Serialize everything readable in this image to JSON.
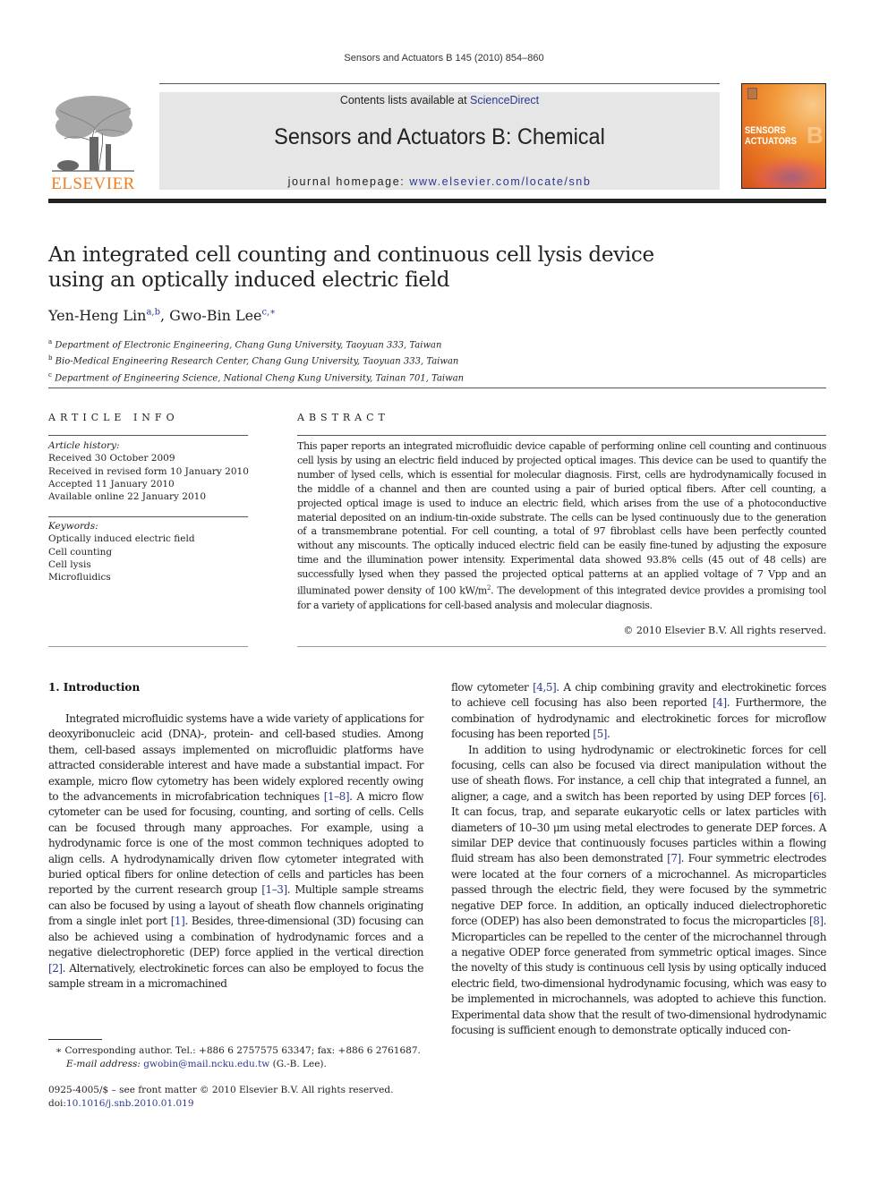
{
  "journal": {
    "running_head": "Sensors and Actuators B 145 (2010) 854–860",
    "contents_prefix": "Contents lists available at ",
    "contents_link": "ScienceDirect",
    "name": "Sensors and Actuators B: Chemical",
    "homepage_prefix": "journal homepage: ",
    "homepage_url": "www.elsevier.com/locate/snb",
    "publisher_logo": "ELSEVIER",
    "cover_title_line1": "SENSORS",
    "cover_title_line2": "ACTUATORS",
    "cover_letter": "B",
    "colors": {
      "link": "#2b3990",
      "logo_orange": "#f07d1f",
      "banner_bg": "#e6e6e6"
    }
  },
  "article": {
    "title_line1": "An integrated cell counting and continuous cell lysis device",
    "title_line2": "using an optically induced electric field",
    "authors": [
      {
        "name": "Yen-Heng Lin",
        "marks": "a,b"
      },
      {
        "name": "Gwo-Bin Lee",
        "marks": "c,∗"
      }
    ],
    "affiliations": [
      {
        "mark": "a",
        "text": "Department of Electronic Engineering, Chang Gung University, Taoyuan 333, Taiwan"
      },
      {
        "mark": "b",
        "text": "Bio-Medical Engineering Research Center, Chang Gung University, Taoyuan 333, Taiwan"
      },
      {
        "mark": "c",
        "text": "Department of Engineering Science, National Cheng Kung University, Tainan 701, Taiwan"
      }
    ]
  },
  "article_info": {
    "heading": "ARTICLE INFO",
    "history_label": "Article history:",
    "history": [
      "Received 30 October 2009",
      "Received in revised form 10 January 2010",
      "Accepted 11 January 2010",
      "Available online 22 January 2010"
    ],
    "keywords_label": "Keywords:",
    "keywords": [
      "Optically induced electric field",
      "Cell counting",
      "Cell lysis",
      "Microfluidics"
    ]
  },
  "abstract": {
    "heading": "ABSTRACT",
    "text_part1": "This paper reports an integrated microfluidic device capable of performing online cell counting and continuous cell lysis by using an electric field induced by projected optical images. This device can be used to quantify the number of lysed cells, which is essential for molecular diagnosis. First, cells are hydrodynamically focused in the middle of a channel and then are counted using a pair of buried optical fibers. After cell counting, a projected optical image is used to induce an electric field, which arises from the use of a photoconductive material deposited on an indium-tin-oxide substrate. The cells can be lysed continuously due to the generation of a transmembrane potential. For cell counting, a total of 97 fibroblast cells have been perfectly counted without any miscounts. The optically induced electric field can be easily fine-tuned by adjusting the exposure time and the illumination power intensity. Experimental data showed 93.8% cells (45 out of 48 cells) are successfully lysed when they passed the projected optical patterns at an applied voltage of 7 Vpp and an illuminated power density of 100 kW/m",
    "text_sup": "2",
    "text_part2": ". The development of this integrated device provides a promising tool for a variety of applications for cell-based analysis and molecular diagnosis.",
    "copyright": "© 2010 Elsevier B.V. All rights reserved."
  },
  "introduction": {
    "heading": "1.  Introduction",
    "left_p1": [
      {
        "t": "Integrated microfluidic systems have a wide variety of applications for deoxyribonucleic acid (DNA)-, protein- and cell-based studies. Among them, cell-based assays implemented on microfluidic platforms have attracted considerable interest and have made a substantial impact. For example, micro flow cytometry has been widely explored recently owing to the advancements in microfabrication techniques "
      },
      {
        "ref": "[1–8]"
      },
      {
        "t": ". A micro flow cytometer can be used for focusing, counting, and sorting of cells. Cells can be focused through many approaches. For example, using a hydrodynamic force is one of the most common techniques adopted to align cells. A hydrodynamically driven flow cytometer integrated with buried optical fibers for online detection of cells and particles has been reported by the current research group "
      },
      {
        "ref": "[1–3]"
      },
      {
        "t": ". Multiple sample streams can also be focused by using a layout of sheath flow channels originating from a single inlet port "
      },
      {
        "ref": "[1]"
      },
      {
        "t": ". Besides, three-dimensional (3D) focusing can also be achieved using a combination of hydrodynamic forces and a negative dielectrophoretic (DEP) force applied in the vertical direction "
      },
      {
        "ref": "[2]"
      },
      {
        "t": ". Alternatively, electrokinetic forces can also be employed to focus the sample stream in a micromachined"
      }
    ],
    "right_p1": [
      {
        "t": "flow cytometer "
      },
      {
        "ref": "[4,5]"
      },
      {
        "t": ". A chip combining gravity and electrokinetic forces to achieve cell focusing has also been reported "
      },
      {
        "ref": "[4]"
      },
      {
        "t": ". Furthermore, the combination of hydrodynamic and electrokinetic forces for microflow focusing has been reported "
      },
      {
        "ref": "[5]"
      },
      {
        "t": "."
      }
    ],
    "right_p2": [
      {
        "t": "In addition to using hydrodynamic or electrokinetic forces for cell focusing, cells can also be focused via direct manipulation without the use of sheath flows. For instance, a cell chip that integrated a funnel, an aligner, a cage, and a switch has been reported by using DEP forces "
      },
      {
        "ref": "[6]"
      },
      {
        "t": ". It can focus, trap, and separate eukaryotic cells or latex particles with diameters of 10–30 μm using metal electrodes to generate DEP forces. A similar DEP device that continuously focuses particles within a flowing fluid stream has also been demonstrated "
      },
      {
        "ref": "[7]"
      },
      {
        "t": ". Four symmetric electrodes were located at the four corners of a microchannel. As microparticles passed through the electric field, they were focused by the symmetric negative DEP force. In addition, an optically induced dielectrophoretic force (ODEP) has also been demonstrated to focus the microparticles "
      },
      {
        "ref": "[8]"
      },
      {
        "t": ". Microparticles can be repelled to the center of the microchannel through a negative ODEP force generated from symmetric optical images. Since the novelty of this study is continuous cell lysis by using optically induced electric field, two-dimensional hydrodynamic focusing, which was easy to be implemented in microchannels, was adopted to achieve this function. Experimental data show that the result of two-dimensional hydrodynamic focusing is sufficient enough to demonstrate optically induced con-"
      }
    ]
  },
  "footnotes": {
    "corresponding_mark": "∗",
    "corresponding_text": "Corresponding author. Tel.: +886 6 2757575 63347; fax: +886 6 2761687.",
    "email_label": "E-mail address: ",
    "email": "gwobin@mail.ncku.edu.tw",
    "email_suffix": " (G.-B. Lee).",
    "front_matter": "0925-4005/$ – see front matter © 2010 Elsevier B.V. All rights reserved.",
    "doi_prefix": "doi:",
    "doi": "10.1016/j.snb.2010.01.019"
  }
}
